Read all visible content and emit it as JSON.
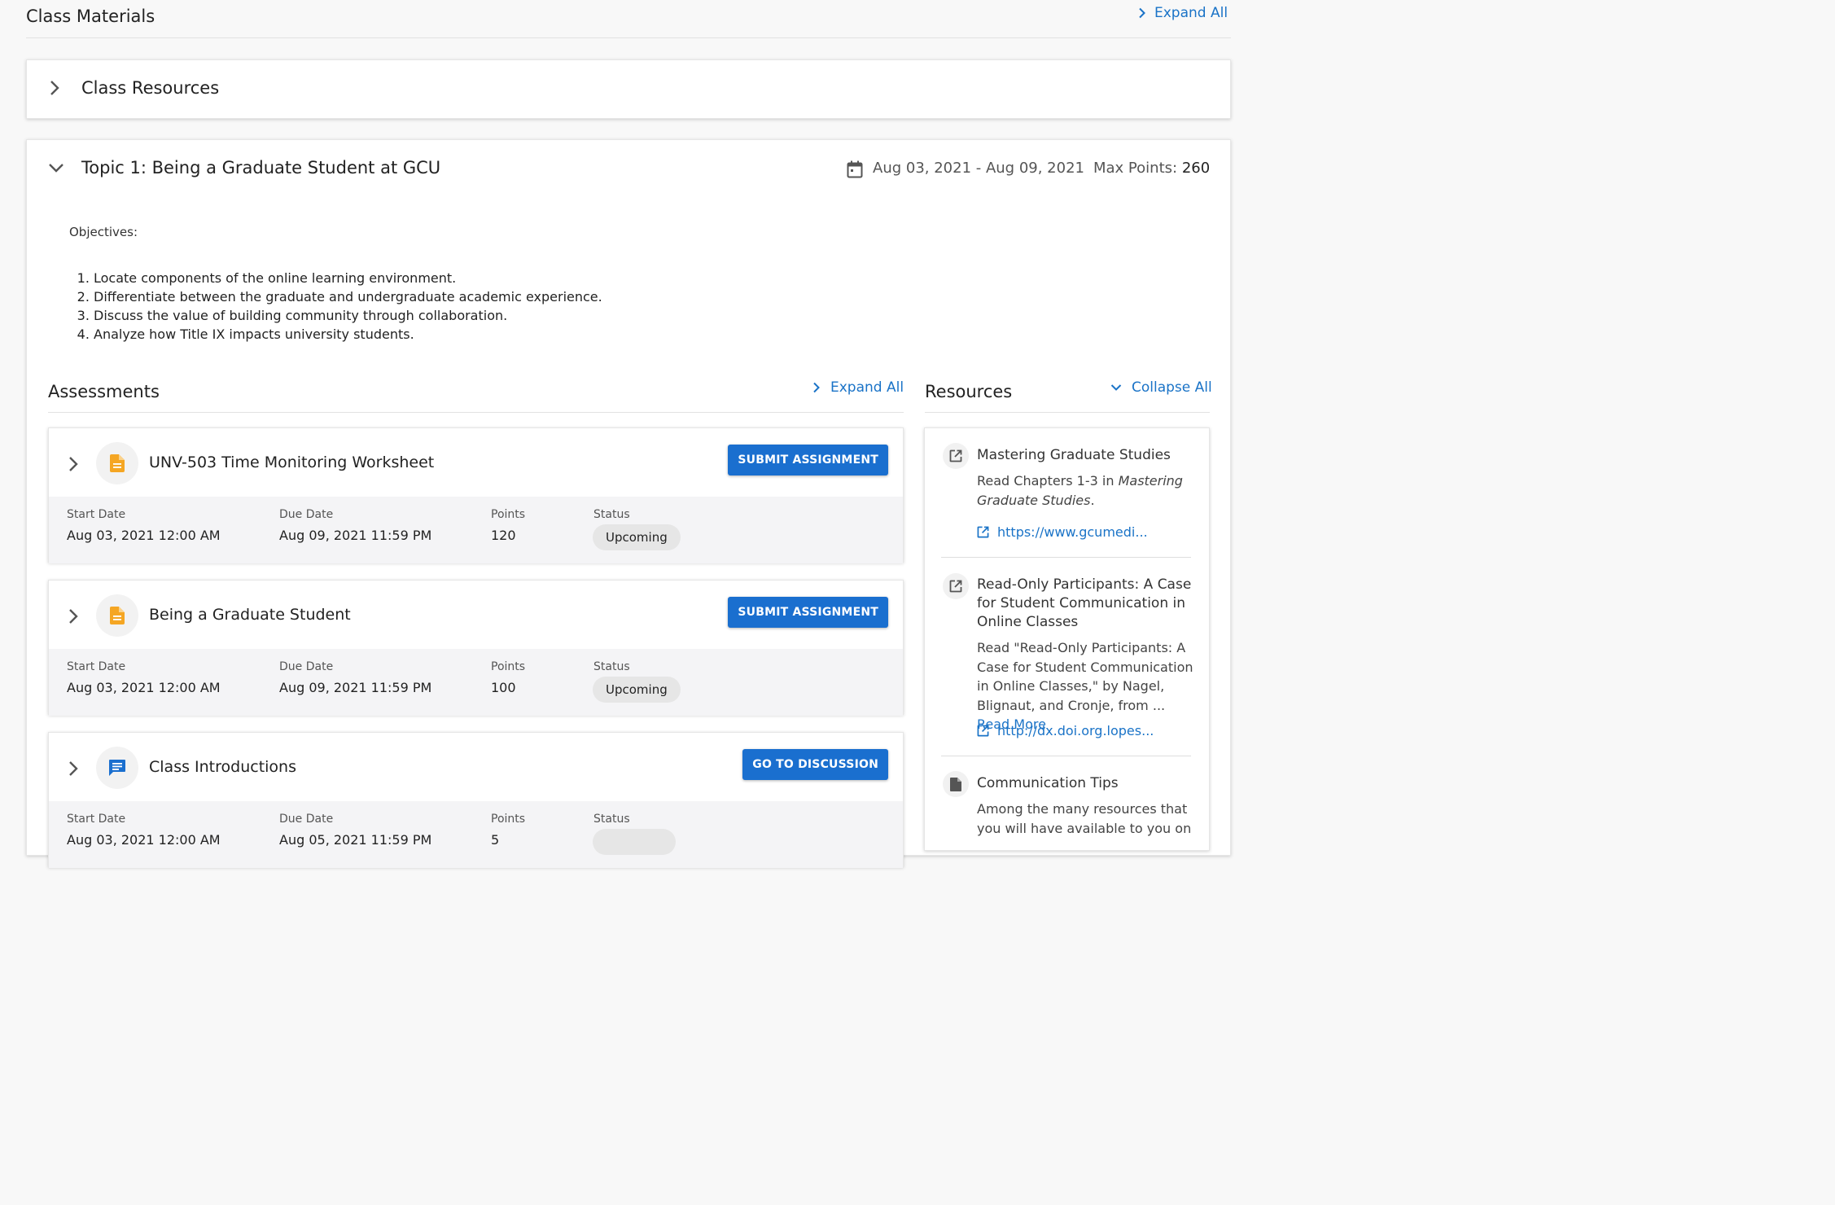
{
  "header": {
    "title": "Class Materials",
    "expand_all": "Expand All"
  },
  "class_resources": {
    "title": "Class Resources"
  },
  "topic": {
    "title": "Topic 1: Being a Graduate Student at GCU",
    "dates": "Aug 03, 2021 - Aug 09, 2021",
    "max_points_label": "Max Points:",
    "max_points_value": "260",
    "objectives_label": "Objectives:",
    "objectives": [
      "Locate components of the online learning environment.",
      "Differentiate between the graduate and undergraduate academic experience.",
      "Discuss the value of building community through collaboration.",
      "Analyze how Title IX impacts university students."
    ]
  },
  "assessments": {
    "title": "Assessments",
    "expand_all": "Expand All",
    "labels": {
      "start": "Start Date",
      "due": "Due Date",
      "points": "Points",
      "status": "Status"
    },
    "items": [
      {
        "name": "UNV-503 Time Monitoring Worksheet",
        "icon": "document-icon",
        "button": "SUBMIT ASSIGNMENT",
        "start": "Aug 03, 2021 12:00 AM",
        "due": "Aug 09, 2021 11:59 PM",
        "points": "120",
        "status": "Upcoming"
      },
      {
        "name": "Being a Graduate Student",
        "icon": "document-icon",
        "button": "SUBMIT ASSIGNMENT",
        "start": "Aug 03, 2021 12:00 AM",
        "due": "Aug 09, 2021 11:59 PM",
        "points": "100",
        "status": "Upcoming"
      },
      {
        "name": "Class Introductions",
        "icon": "discussion-icon",
        "button": "GO TO DISCUSSION",
        "start": "Aug 03, 2021 12:00 AM",
        "due": "Aug 05, 2021 11:59 PM",
        "points": "5",
        "status": ""
      }
    ]
  },
  "resources": {
    "title": "Resources",
    "collapse_all": "Collapse All",
    "items": [
      {
        "title": "Mastering Graduate Studies",
        "desc_prefix": "Read Chapters 1-3 in ",
        "desc_italic": "Mastering Graduate Studies",
        "desc_suffix": ".",
        "link": "https://www.gcumedi...",
        "icon": "external-link-icon"
      },
      {
        "title": "Read-Only Participants: A Case for Student Communication in Online Classes",
        "desc": "Read \"Read-Only Participants: A Case for Student Communication in Online Classes,\" by Nagel, Blignaut, and Cronje, from ...",
        "read_more": "Read More",
        "link": "http://dx.doi.org.lopes...",
        "icon": "external-link-icon"
      },
      {
        "title": "Communication Tips",
        "desc": "Among the many resources that you will have available to you on",
        "icon": "file-icon"
      }
    ]
  },
  "colors": {
    "accent": "#1a73c7",
    "button": "#1a6fcf",
    "doc_icon": "#f5a623",
    "discussion_icon": "#1a6fcf"
  }
}
